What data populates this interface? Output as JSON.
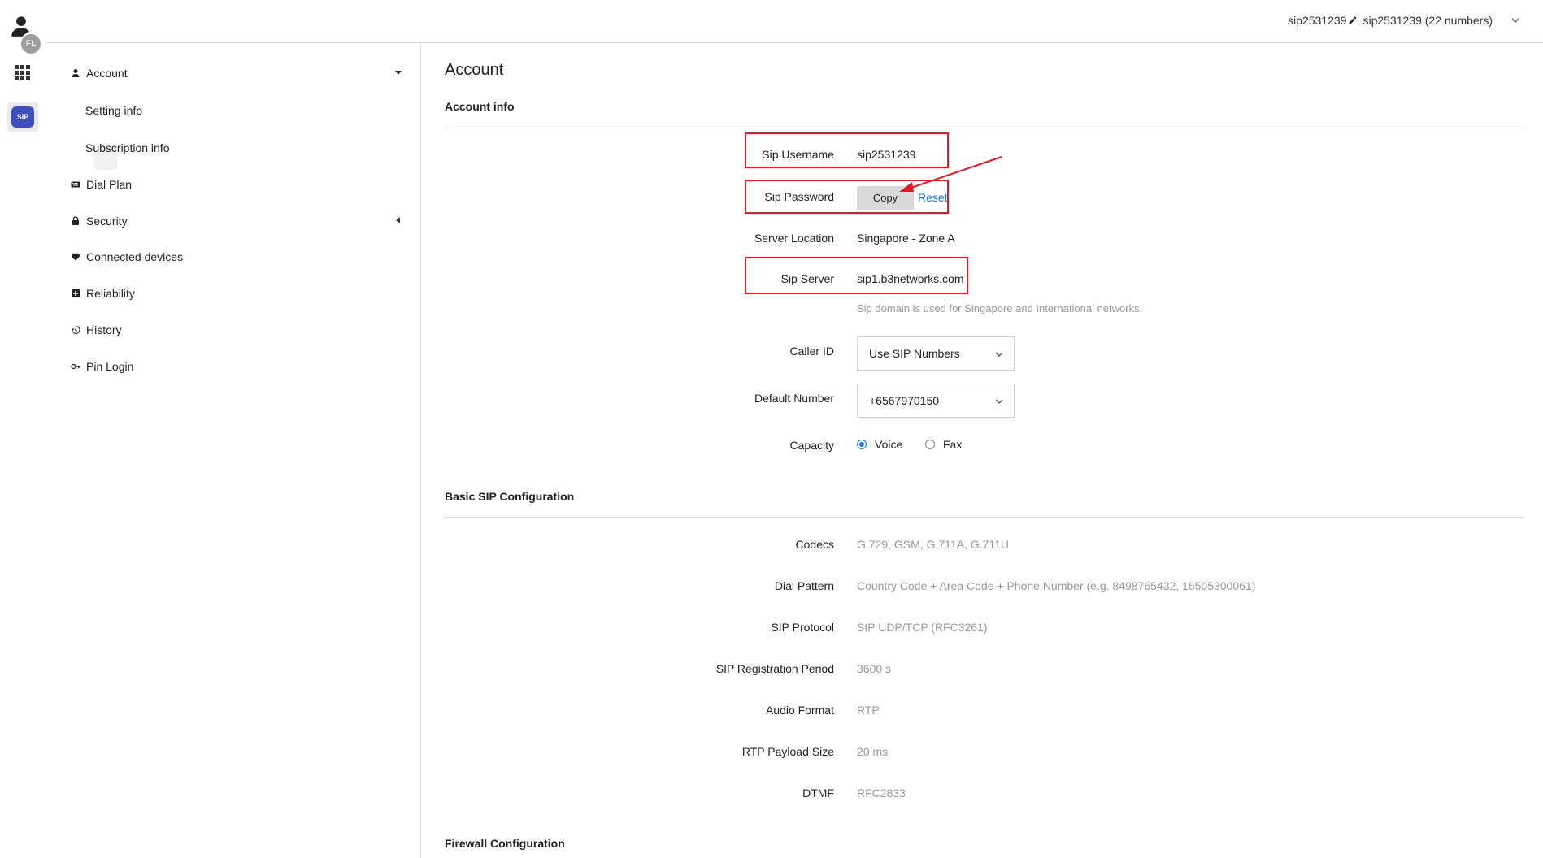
{
  "rail": {
    "avatar_initials": "FL",
    "apps_icon": "grid-icon",
    "sip_badge": "SIP",
    "accent": "#3d4fb8"
  },
  "topbar": {
    "username": "sip2531239",
    "numbers_label": "sip2531239 (22 numbers)"
  },
  "sidebar": {
    "items": [
      {
        "label": "Account",
        "icon": "person-icon"
      },
      {
        "label": "Setting info",
        "icon": ""
      },
      {
        "label": "Subscription info",
        "icon": ""
      },
      {
        "label": "Dial Plan",
        "icon": "keyboard-icon"
      },
      {
        "label": "Security",
        "icon": "lock-icon"
      },
      {
        "label": "Connected devices",
        "icon": "heart-icon"
      },
      {
        "label": "Reliability",
        "icon": "plus-box-icon"
      },
      {
        "label": "History",
        "icon": "history-icon"
      },
      {
        "label": "Pin Login",
        "icon": "key-icon"
      }
    ]
  },
  "main": {
    "title": "Account",
    "account_info": {
      "heading": "Account info",
      "sip_username_label": "Sip Username",
      "sip_username_value": "sip2531239",
      "sip_password_label": "Sip Password",
      "copy_label": "Copy",
      "reset_label": "Reset",
      "server_location_label": "Server Location",
      "server_location_value": "Singapore - Zone A",
      "sip_server_label": "Sip Server",
      "sip_server_value": "sip1.b3networks.com",
      "sip_server_hint": "Sip domain is used for Singapore and International networks.",
      "caller_id_label": "Caller ID",
      "caller_id_value": "Use SIP Numbers",
      "default_number_label": "Default Number",
      "default_number_value": "+6567970150",
      "capacity_label": "Capacity",
      "capacity_options": [
        "Voice",
        "Fax"
      ],
      "capacity_selected": "Voice"
    },
    "basic_sip": {
      "heading": "Basic SIP Configuration",
      "rows": [
        {
          "label": "Codecs",
          "value": "G.729, GSM, G.711A, G.711U"
        },
        {
          "label": "Dial Pattern",
          "value": "Country Code + Area Code + Phone Number (e.g. 8498765432, 16505300061)"
        },
        {
          "label": "SIP Protocol",
          "value": "SIP UDP/TCP (RFC3261)"
        },
        {
          "label": "SIP Registration Period",
          "value": "3600 s"
        },
        {
          "label": "Audio Format",
          "value": "RTP"
        },
        {
          "label": "RTP Payload Size",
          "value": "20 ms"
        },
        {
          "label": "DTMF",
          "value": "RFC2833"
        }
      ]
    },
    "firewall": {
      "heading": "Firewall Configuration"
    }
  },
  "colors": {
    "highlight_box": "#e0192b",
    "link": "#1a73e8",
    "muted_text": "#9a9a9a"
  }
}
